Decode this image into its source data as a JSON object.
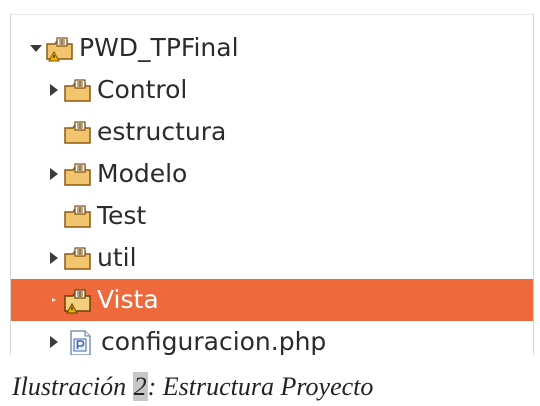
{
  "tree": {
    "items": [
      {
        "label": "PWD_TPFinal",
        "type": "project",
        "expanded": true,
        "has_children": true,
        "selected": false,
        "icon": "project-icon"
      },
      {
        "label": "Control",
        "type": "package-folder",
        "expanded": false,
        "has_children": true,
        "selected": false,
        "icon": "package-folder-icon"
      },
      {
        "label": "estructura",
        "type": "package-folder",
        "expanded": false,
        "has_children": false,
        "selected": false,
        "icon": "package-folder-icon"
      },
      {
        "label": "Modelo",
        "type": "package-folder",
        "expanded": false,
        "has_children": true,
        "selected": false,
        "icon": "package-folder-icon"
      },
      {
        "label": "Test",
        "type": "package-folder",
        "expanded": false,
        "has_children": false,
        "selected": false,
        "icon": "package-folder-icon"
      },
      {
        "label": "util",
        "type": "package-folder",
        "expanded": false,
        "has_children": true,
        "selected": false,
        "icon": "package-folder-icon"
      },
      {
        "label": "Vista",
        "type": "package-folder",
        "expanded": false,
        "has_children": true,
        "selected": true,
        "icon": "package-folder-warning-icon"
      },
      {
        "label": "configuracion.php",
        "type": "php-file",
        "expanded": false,
        "has_children": true,
        "selected": false,
        "icon": "php-file-icon"
      }
    ]
  },
  "caption": {
    "prefix": "Ilustración ",
    "number": "2",
    "suffix": ": Estructura Proyecto"
  },
  "colors": {
    "selection": "#ee6a3c",
    "folder_fill": "#f2c46d",
    "folder_stroke": "#8a5a12",
    "php_blue": "#3d66b0",
    "warning": "#f0b400"
  }
}
